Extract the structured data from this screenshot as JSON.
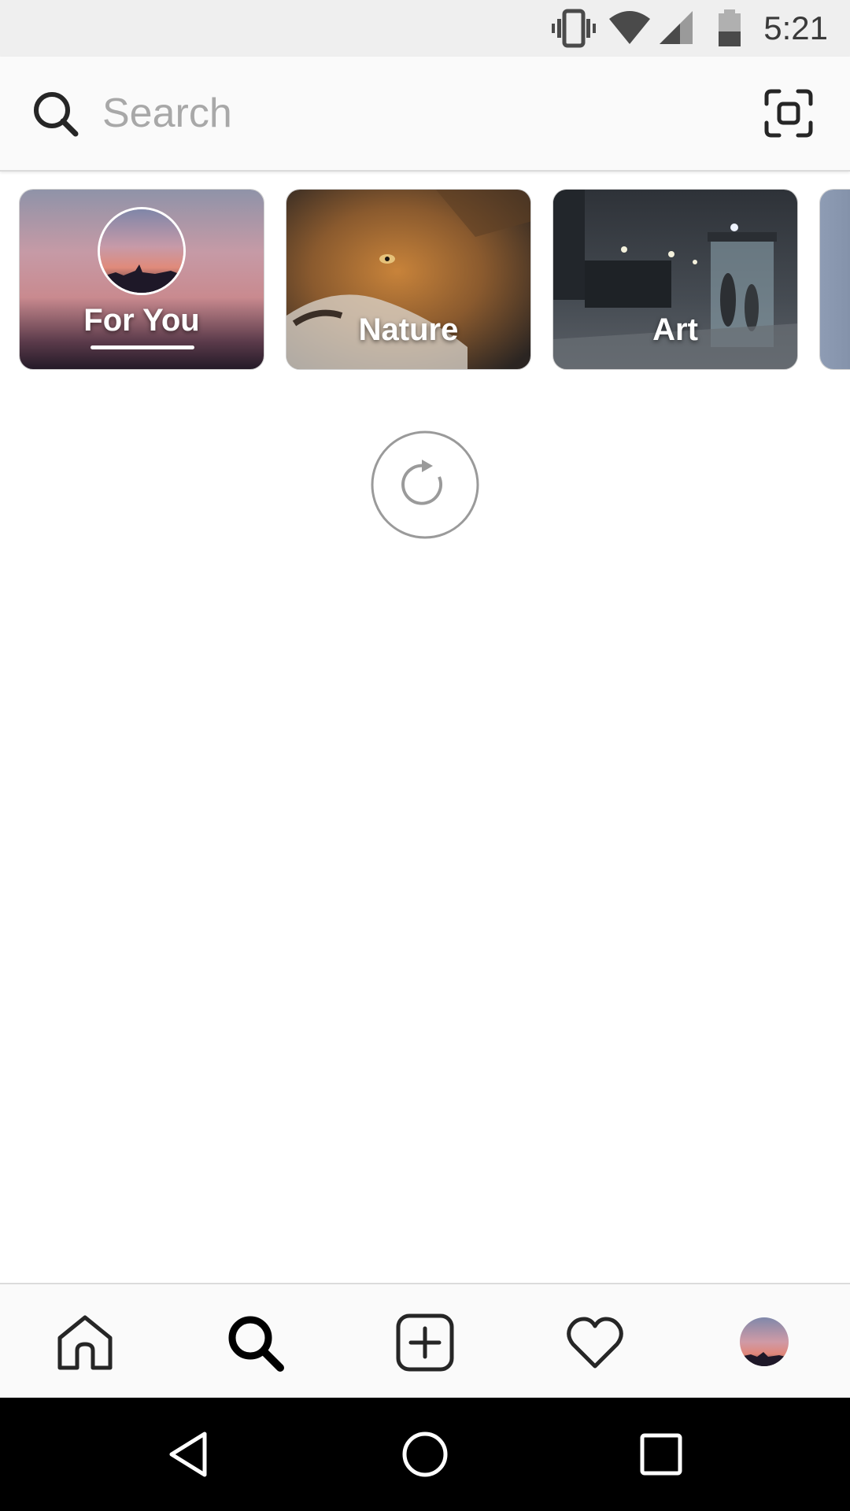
{
  "status_bar": {
    "time": "5:21",
    "icons": [
      "vibrate-icon",
      "wifi-icon",
      "cell-signal-icon",
      "battery-icon"
    ]
  },
  "search": {
    "placeholder": "Search",
    "value": "",
    "left_icon": "search-icon",
    "right_icon": "scan-icon"
  },
  "categories": [
    {
      "label": "For You",
      "selected": true
    },
    {
      "label": "Nature",
      "selected": false
    },
    {
      "label": "Art",
      "selected": false
    },
    {
      "label": "",
      "selected": false
    }
  ],
  "loading": {
    "icon": "reload-icon"
  },
  "bottom_nav": {
    "items": [
      "home-icon",
      "search-icon",
      "add-post-icon",
      "heart-icon",
      "profile-avatar"
    ],
    "active": "search-icon"
  },
  "system_nav": {
    "items": [
      "back-icon",
      "home-circle-icon",
      "recents-icon"
    ]
  },
  "colors": {
    "status_bar_bg": "#efefef",
    "header_bg": "#fafafa",
    "placeholder": "#a8a8a8",
    "icon": "#262626",
    "system_nav_bg": "#000000"
  }
}
